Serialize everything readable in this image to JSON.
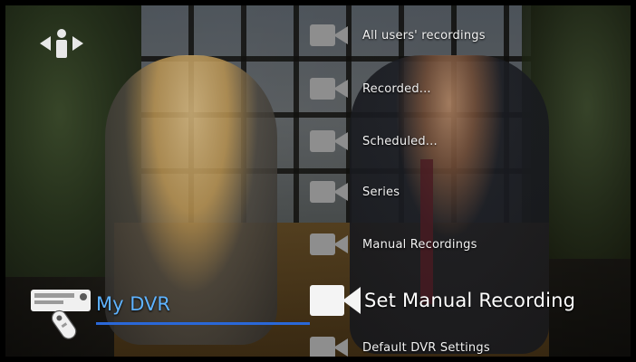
{
  "menu": {
    "items": [
      {
        "label": "All users' recordings"
      },
      {
        "label": "Recorded..."
      },
      {
        "label": "Scheduled..."
      },
      {
        "label": "Series"
      },
      {
        "label": "Manual Recordings"
      },
      {
        "label": "Set Manual Recording"
      },
      {
        "label": "Default DVR Settings"
      }
    ],
    "selected_index": 5
  },
  "section": {
    "title": "My DVR"
  },
  "icons": {
    "info": "info-icon",
    "dvr": "dvr-remote-icon",
    "menu_item": "video-camera-icon"
  },
  "colors": {
    "accent": "#2a68d8",
    "section_title": "#5fb3ff"
  }
}
